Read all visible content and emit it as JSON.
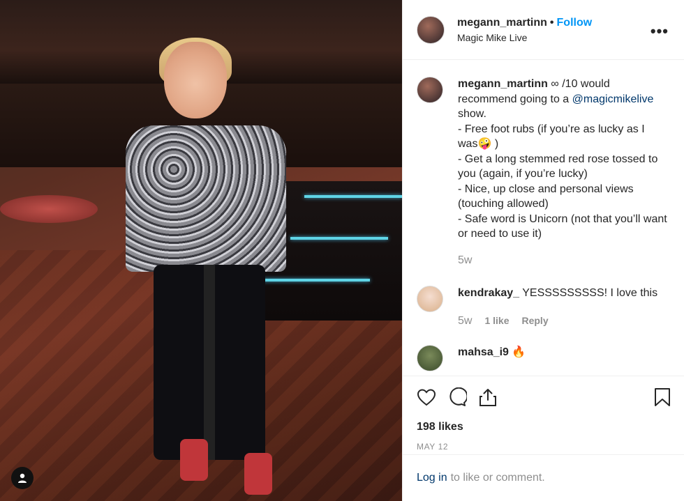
{
  "post": {
    "username": "megann_martinn",
    "follow_label": "Follow",
    "location": "Magic Mike Live",
    "more_icon": "more-horizontal-icon"
  },
  "caption": {
    "username": "megann_martinn",
    "text_before_mention": "∞ /10 would recommend going to a ",
    "mention": "@magicmikelive",
    "text_after_mention": " show.",
    "lines": [
      "- Free foot rubs (if you’re as lucky as I was🤪 )",
      "- Get a long stemmed red rose tossed to you (again, if you’re lucky)",
      "- Nice, up close and personal views (touching allowed)",
      "- Safe word is Unicorn (not that you’ll want or need to use it)"
    ],
    "time": "5w"
  },
  "comments": [
    {
      "username": "kendrakay_",
      "text": "YESSSSSSSSS! I love this",
      "time": "5w",
      "likes": "1 like",
      "reply": "Reply"
    },
    {
      "username": "mahsa_i9",
      "text": "🔥"
    }
  ],
  "actions": {
    "like_icon": "heart-icon",
    "comment_icon": "comment-icon",
    "share_icon": "share-icon",
    "save_icon": "bookmark-icon",
    "likes": "198 likes",
    "date": "MAY 12"
  },
  "login_bar": {
    "login_label": "Log in",
    "prompt": "to like or comment."
  }
}
